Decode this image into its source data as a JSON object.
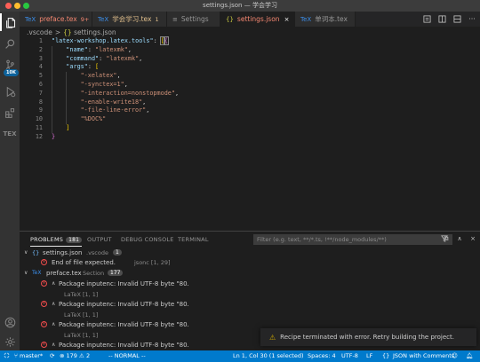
{
  "window": {
    "title": "settings.json — 学会学习"
  },
  "tabs": [
    {
      "icon": "tex",
      "label": "preface.tex",
      "meta": "9+",
      "active": false,
      "color": "#f48771"
    },
    {
      "icon": "tex",
      "label": "学会学习.tex",
      "meta": "1",
      "active": false,
      "color": "#e2c08d"
    },
    {
      "icon": "settings",
      "label": "Settings",
      "meta": "",
      "active": false,
      "color": "#cccccc"
    },
    {
      "icon": "json",
      "label": "settings.json",
      "meta": "",
      "active": true,
      "color": "#f48771"
    },
    {
      "icon": "tex",
      "label": "单词本.tex",
      "meta": "",
      "active": false,
      "color": "#cccccc"
    }
  ],
  "breadcrumb": {
    "folder": ".vscode",
    "sep": ">",
    "braces": "{}",
    "file": "settings.json"
  },
  "editor": {
    "lines": [
      {
        "n": "1",
        "indent": 0,
        "parts": [
          [
            "k",
            "\"latex-workshop.latex.tools\""
          ],
          [
            "p",
            ": "
          ],
          [
            "bk",
            "["
          ],
          [
            "bk2",
            "{"
          ]
        ]
      },
      {
        "n": "2",
        "indent": 1,
        "parts": [
          [
            "k",
            "\"name\""
          ],
          [
            "p",
            ": "
          ],
          [
            "s",
            "\"latexmk\""
          ],
          [
            "p",
            ","
          ]
        ]
      },
      {
        "n": "3",
        "indent": 1,
        "parts": [
          [
            "k",
            "\"command\""
          ],
          [
            "p",
            ": "
          ],
          [
            "s",
            "\"latexmk\""
          ],
          [
            "p",
            ","
          ]
        ]
      },
      {
        "n": "4",
        "indent": 1,
        "parts": [
          [
            "k",
            "\"args\""
          ],
          [
            "p",
            ": "
          ],
          [
            "bk",
            "["
          ]
        ]
      },
      {
        "n": "5",
        "indent": 2,
        "parts": [
          [
            "s",
            "\"-xelatex\""
          ],
          [
            "p",
            ","
          ]
        ]
      },
      {
        "n": "6",
        "indent": 2,
        "parts": [
          [
            "s",
            "\"-synctex=1\""
          ],
          [
            "p",
            ","
          ]
        ]
      },
      {
        "n": "7",
        "indent": 2,
        "parts": [
          [
            "s",
            "\"-interaction=nonstopmode\""
          ],
          [
            "p",
            ","
          ]
        ]
      },
      {
        "n": "8",
        "indent": 2,
        "parts": [
          [
            "s",
            "\"-enable-write18\""
          ],
          [
            "p",
            ","
          ]
        ]
      },
      {
        "n": "9",
        "indent": 2,
        "parts": [
          [
            "s",
            "\"-file-line-error\""
          ],
          [
            "p",
            ","
          ]
        ]
      },
      {
        "n": "10",
        "indent": 2,
        "parts": [
          [
            "s",
            "\"%DOC%\""
          ]
        ]
      },
      {
        "n": "11",
        "indent": 1,
        "parts": [
          [
            "bk",
            "]"
          ]
        ]
      },
      {
        "n": "12",
        "indent": 0,
        "parts": [
          [
            "bk2",
            "}"
          ]
        ]
      }
    ]
  },
  "panel": {
    "tabs": [
      {
        "label": "PROBLEMS",
        "count": "181",
        "active": true
      },
      {
        "label": "OUTPUT",
        "count": "",
        "active": false
      },
      {
        "label": "DEBUG CONSOLE",
        "count": "",
        "active": false
      },
      {
        "label": "TERMINAL",
        "count": "",
        "active": false
      }
    ],
    "filter_placeholder": "Filter (e.g. text, **/*.ts, !**/node_modules/**)",
    "groups": [
      {
        "file": "settings.json",
        "dir": ".vscode",
        "count": "1"
      },
      {
        "file": "preface.tex",
        "dir": "Section",
        "count": "177"
      }
    ],
    "rows": [
      {
        "kind": "error",
        "text": "End of file expected.",
        "detail": "jsonc [1, 29]"
      },
      {
        "kind": "error",
        "text": "Package inputenc: Invalid UTF-8 byte \"80.",
        "detail": ""
      },
      {
        "kind": "detail",
        "text": "LaTeX [1, 1]",
        "detail": ""
      },
      {
        "kind": "error",
        "text": "Package inputenc: Invalid UTF-8 byte \"80.",
        "detail": ""
      },
      {
        "kind": "detail",
        "text": "LaTeX [1, 1]",
        "detail": ""
      },
      {
        "kind": "error",
        "text": "Package inputenc: Invalid UTF-8 byte \"80.",
        "detail": ""
      },
      {
        "kind": "detail",
        "text": "LaTeX [1, 1]",
        "detail": ""
      },
      {
        "kind": "error",
        "text": "Package inputenc: Invalid UTF-8 byte \"80.",
        "detail": ""
      }
    ]
  },
  "notification": {
    "text": "Recipe terminated with error. Retry building the project."
  },
  "activity": {
    "badge": "10K",
    "tex_label": "TEX"
  },
  "status": {
    "branch": "master*",
    "errors": "179",
    "warnings": "2",
    "mode": "-- NORMAL --",
    "position": "Ln 1, Col 30 (1 selected)",
    "spaces": "Spaces: 4",
    "encoding": "UTF-8",
    "eol": "LF",
    "braces": "{}",
    "language": "JSON with Comments"
  }
}
